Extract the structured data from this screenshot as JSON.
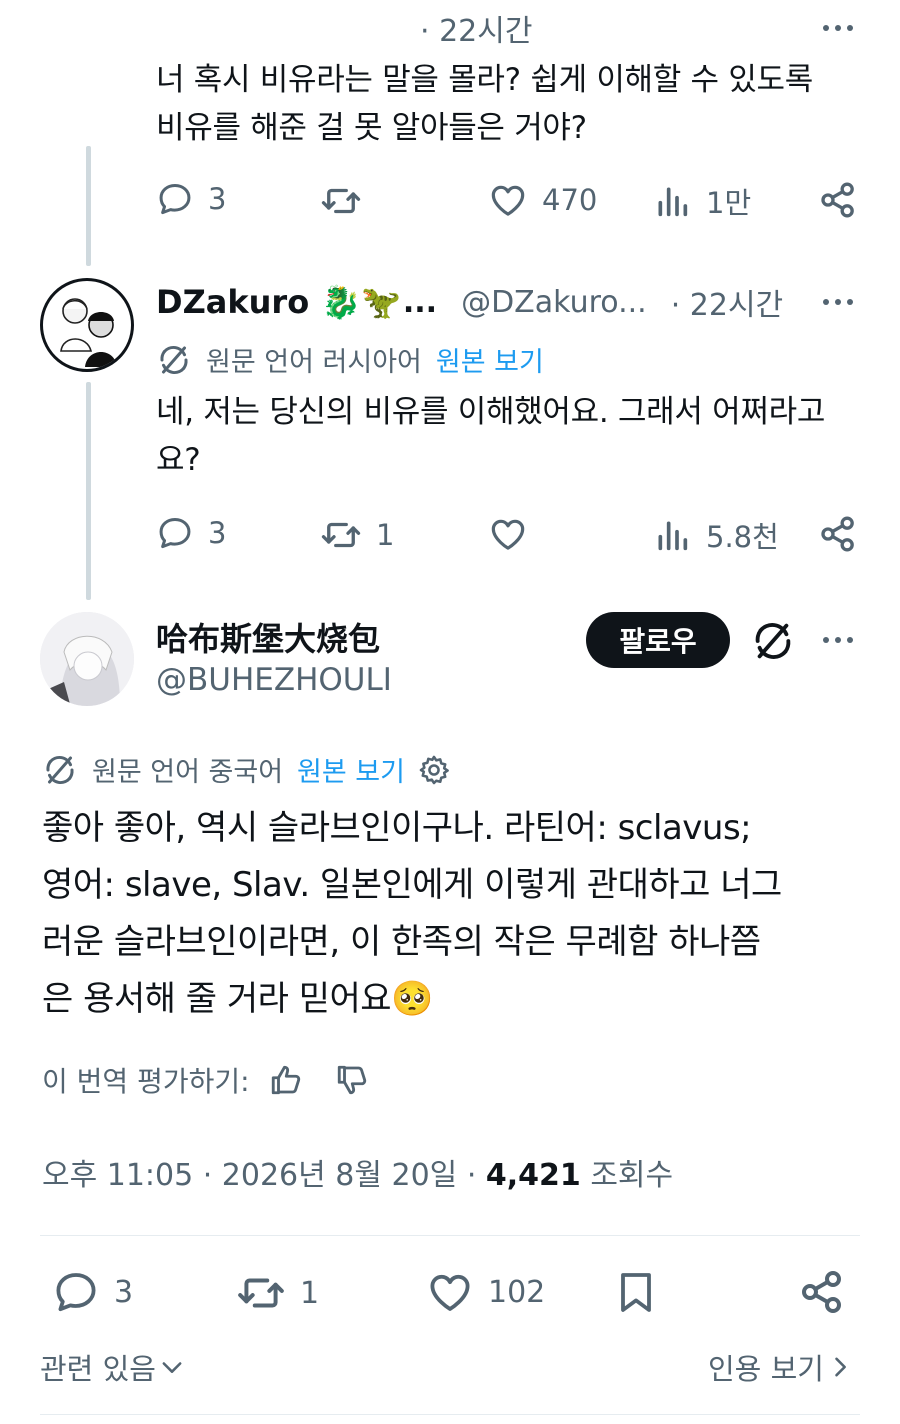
{
  "post1": {
    "time": "· 22시간",
    "text_line1": "너 혹시 비유라는 말을 몰라? 쉽게 이해할 수 있도록",
    "text_line2": "비유를 해준 걸 못 알아들은 거야?",
    "replies": "3",
    "likes": "470",
    "views": "1만"
  },
  "post2": {
    "author_name": "DZakuro",
    "author_emojis": "🐉🦖",
    "ellipsis": "...",
    "handle": "@DZakuro...",
    "time": "· 22시간",
    "translation_label": "원문 언어 러시아어",
    "show_original": "원본 보기",
    "text_line1": "네, 저는 당신의 비유를 이해했어요. 그래서 어쩌라고",
    "text_line2": "요?",
    "replies": "3",
    "reposts": "1",
    "views": "5.8천"
  },
  "main_post": {
    "author_name": "哈布斯堡大烧包",
    "handle": "@BUHEZHOULI",
    "follow_label": "팔로우",
    "translation_label": "원문 언어 중국어",
    "show_original": "원본 보기",
    "text_lines": [
      "좋아 좋아, 역시 슬라브인이구나. 라틴어: sclavus;",
      "영어: slave, Slav. 일본인에게 이렇게 관대하고 너그",
      "러운 슬라브인이라면, 이 한족의 작은 무례함 하나쯤",
      "은 용서해 줄 거라 믿어요🥺"
    ],
    "rate_translation": "이 번역 평가하기:",
    "timestamp": "오후 11:05 · 2026년 8월 20일 · ",
    "views_count": "4,421",
    "views_label": " 조회수",
    "replies": "3",
    "reposts": "1",
    "likes": "102",
    "related": "관련 있음",
    "quotes": "인용 보기"
  },
  "icons": {
    "reply": "reply-icon",
    "repost": "repost-icon",
    "like": "heart-icon",
    "views": "views-icon",
    "share": "share-icon",
    "bookmark": "bookmark-icon",
    "translate": "translate-icon",
    "more": "more-icon",
    "settings": "gear-icon",
    "thumbs_up": "thumbs-up-icon",
    "thumbs_down": "thumbs-down-icon",
    "chevron_down": "chevron-down-icon",
    "chevron_right": "chevron-right-icon"
  },
  "colors": {
    "text": "#0f1419",
    "secondary": "#536471",
    "link": "#1d9bf0",
    "thread_line": "#cfd9de"
  }
}
